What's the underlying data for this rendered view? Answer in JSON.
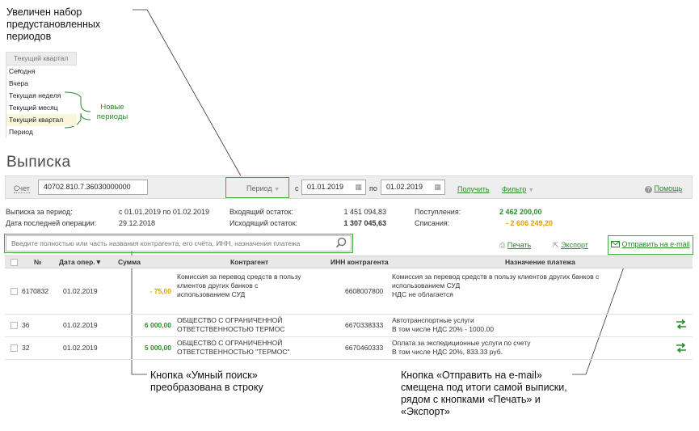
{
  "annotations": {
    "top_note": [
      "Увеличен набор",
      "предустановленных",
      "периодов"
    ],
    "new_periods": [
      "Новые",
      "периоды"
    ],
    "search_note": [
      "Кнопка «Умный поиск»",
      "преобразована в строку"
    ],
    "email_note": [
      "Кнопка «Отправить на e-mail»",
      "смещена под итоги самой выписки,",
      "рядом с кнопками  «Печать» и",
      "«Экспорт»"
    ]
  },
  "period_dropdown": {
    "selected": "Текущий квартал",
    "options": [
      "Сегодня",
      "Вчера",
      "Текущая неделя",
      "Текущий месяц",
      "Текущий квартал",
      "Период"
    ]
  },
  "page_title": "Выписка",
  "toolbar": {
    "account_label": "Счет",
    "account_value": "40702.810.7.36030000000",
    "period_label": "Период",
    "from_label": "с",
    "from_date": "01.01.2019",
    "to_label": "по",
    "to_date": "01.02.2019",
    "get_label": "Получить",
    "filter_label": "Фильтр",
    "help_label": "Помощь"
  },
  "summary": {
    "period_label": "Выписка за период:",
    "period_value": "с 01.01.2019 по 01.02.2019",
    "last_op_label": "Дата последней операции:",
    "last_op_value": "29.12.2018",
    "in_label": "Входящий остаток:",
    "in_value": "1 451 094,83",
    "out_label": "Исходящий остаток:",
    "out_value": "1 307 045,63",
    "income_label": "Поступления:",
    "income_value": "2 462 200,00",
    "expense_label": "Списания:",
    "expense_value": "- 2 606 249,20"
  },
  "search": {
    "placeholder": "Введите полностью или часть названия контрагента, его счёта, ИНН, назначения платежа"
  },
  "actions": {
    "print": "Печать",
    "export": "Экспорт",
    "email": "Отправить на e-mail"
  },
  "table": {
    "headers": [
      "№",
      "Дата опер.▼",
      "Сумма",
      "Контрагент",
      "ИНН контрагента",
      "Назначение платежа"
    ],
    "rows": [
      {
        "num": "6170832",
        "date": "01.02.2019",
        "amount": "- 75,00",
        "counterparty": [
          "Комиссия за перевод средств в пользу",
          "клиентов других банков с",
          "использованием СУД"
        ],
        "inn": "6608007800",
        "purpose": [
          "Комиссия за перевод средств в пользу клиентов других банков с",
          "использованием СУД",
          "НДС не облагается"
        ]
      },
      {
        "num": "36",
        "date": "01.02.2019",
        "amount": "6 000,00",
        "counterparty": [
          "ОБЩЕСТВО С ОГРАНИЧЕННОЙ",
          "ОТВЕТСТВЕННОСТЬЮ ТЕРМОС"
        ],
        "inn": "6670338333",
        "purpose": [
          "Автотранспортные услуги",
          "В том  числе НДС 20% - 1000.00"
        ]
      },
      {
        "num": "32",
        "date": "01.02.2019",
        "amount": "5 000,00",
        "counterparty": [
          "ОБЩЕСТВО С ОГРАНИЧЕННОЙ",
          "ОТВЕТСТВЕННОСТЬЮ \"ТЕРМОС\""
        ],
        "inn": "6670460333",
        "purpose": [
          "Оплата за экспедиционные услуги по счету",
          "В том числе НДС 20%, 833.33 руб."
        ]
      }
    ]
  },
  "colors": {
    "green": "#2d8a2d",
    "orange": "#e0a000",
    "highlight": "#3aaa3a"
  }
}
